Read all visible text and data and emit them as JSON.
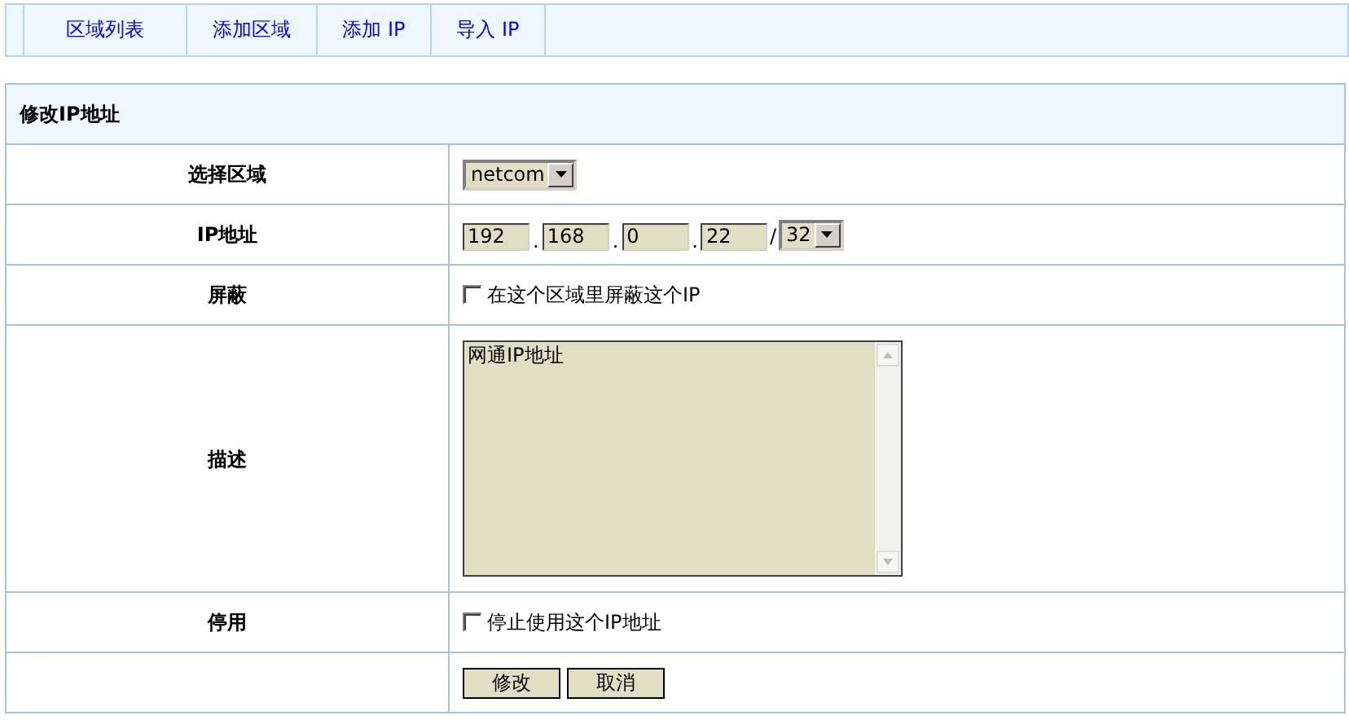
{
  "tabs": [
    {
      "label": "区域列表"
    },
    {
      "label": "添加区域"
    },
    {
      "label": "添加 IP"
    },
    {
      "label": "导入 IP"
    }
  ],
  "form": {
    "title": "修改IP地址",
    "rows": [
      {
        "kind": "select",
        "label": "选择区域",
        "value": "netcom"
      },
      {
        "kind": "ip",
        "label": "IP地址",
        "octets": [
          "192",
          "168",
          "0",
          "22"
        ],
        "separators": [
          ".",
          ".",
          "."
        ],
        "slash": "/",
        "prefix": "32"
      },
      {
        "kind": "checkbox",
        "label": "屏蔽",
        "text": "在这个区域里屏蔽这个IP",
        "checked": false
      },
      {
        "kind": "textarea",
        "label": "描述",
        "value": "网通IP地址"
      },
      {
        "kind": "checkbox",
        "label": "停用",
        "text": "停止使用这个IP地址",
        "checked": false
      },
      {
        "kind": "buttons",
        "buttons": [
          "修改",
          "取消"
        ]
      }
    ]
  }
}
